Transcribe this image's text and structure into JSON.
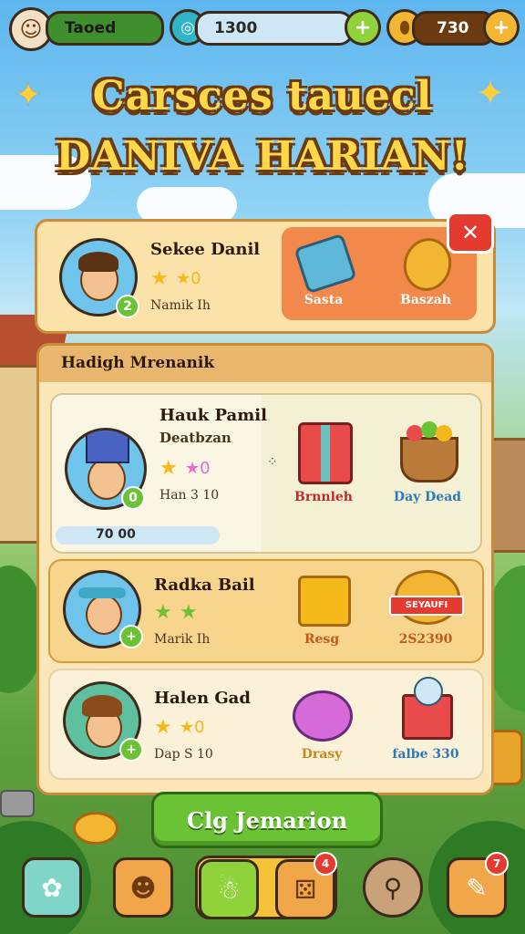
{
  "top_bar": {
    "player_name": "Taoed",
    "gems_value": "1300",
    "gold_value": "730"
  },
  "title": {
    "line1": "Carsces tauecl",
    "line2": "DANIVA HARIAN!"
  },
  "featured": {
    "name": "Sekee Danil",
    "sub": "Namik Ih",
    "level": "2",
    "rewards": [
      {
        "label": "Sasta",
        "icon": "crystal-icon"
      },
      {
        "label": "Baszah",
        "icon": "coin-icon"
      }
    ]
  },
  "panel": {
    "header": "Hadigh Mrenanik"
  },
  "missions": [
    {
      "name": "Hauk Pamil",
      "subtitle": "Deatbzan",
      "meta": "Han 3 10",
      "level": "0",
      "progress": "70 00",
      "rewards": [
        {
          "label": "Brnnleh",
          "icon": "gift-icon"
        },
        {
          "label": "Day Dead",
          "icon": "fruit-basket-icon"
        }
      ]
    },
    {
      "name": "Radka Bail",
      "subtitle": "",
      "meta": "Marik Ih",
      "level": "+",
      "rewards": [
        {
          "label": "Resg",
          "icon": "chest-icon"
        },
        {
          "label": "2S2390",
          "banner": "SEYAUFI",
          "icon": "gold-stack-icon"
        }
      ]
    },
    {
      "name": "Halen Gad",
      "subtitle": "",
      "meta": "Dap S 10",
      "level": "+",
      "rewards": [
        {
          "label": "Drasy",
          "icon": "potion-icon"
        },
        {
          "label": "falbe 330",
          "icon": "toy-box-icon"
        }
      ]
    }
  ],
  "cta": {
    "label": "Clg Jemarion"
  },
  "bottom_nav": {
    "items": [
      {
        "icon": "star-home-icon"
      },
      {
        "icon": "face-icon"
      },
      {
        "icon": "character-icon"
      },
      {
        "icon": "dice-icon",
        "badge": "4"
      },
      {
        "icon": "search-icon"
      },
      {
        "icon": "chat-icon",
        "badge": "7"
      }
    ]
  },
  "colors": {
    "gold": "#ffd84a",
    "green": "#6bc234",
    "orange": "#f2884a",
    "panel": "#fbe6b8"
  }
}
